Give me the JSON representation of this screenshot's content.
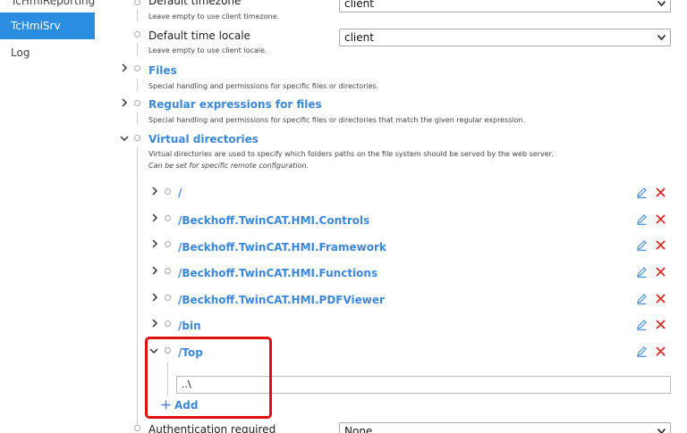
{
  "sidebar": {
    "items": [
      {
        "label": "TcHmiReporting",
        "active": false
      },
      {
        "label": "TcHmiSrv",
        "active": true
      },
      {
        "label": "Log",
        "active": false
      }
    ]
  },
  "settings": {
    "default_timezone": {
      "title": "Default timezone",
      "desc": "Leave empty to use client timezone.",
      "value": "client"
    },
    "default_time_locale": {
      "title": "Default time locale",
      "desc": "Leave empty to use client locale.",
      "value": "client"
    },
    "files": {
      "title": "Files",
      "desc": "Special handling and permissions for specific files or directories."
    },
    "regex": {
      "title": "Regular expressions for files",
      "desc": "Special handling and permissions for specific files or directories that match the given regular expression."
    },
    "virtual_directories": {
      "title": "Virtual directories",
      "desc": "Virtual directories are used to specify which folders paths on the file system should be served by the web server.",
      "desc2": "Can be set for specific remote configuration.",
      "entries": [
        {
          "path": "/"
        },
        {
          "path": "/Beckhoff.TwinCAT.HMI.Controls"
        },
        {
          "path": "/Beckhoff.TwinCAT.HMI.Framework"
        },
        {
          "path": "/Beckhoff.TwinCAT.HMI.Functions"
        },
        {
          "path": "/Beckhoff.TwinCAT.HMI.PDFViewer"
        },
        {
          "path": "/bin"
        },
        {
          "path": "/Top"
        }
      ],
      "top_value": "..\\",
      "add_label": "Add"
    },
    "authentication_required": {
      "title": "Authentication required",
      "value": "None"
    }
  },
  "colors": {
    "accent": "#2a8de0",
    "link": "#3d87d6",
    "delete": "#e02020",
    "highlight": "#e01010"
  },
  "icons": {
    "expand": "chevron-right-icon",
    "collapse": "chevron-down-icon",
    "edit": "pencil-icon",
    "delete": "close-icon",
    "add": "plus-icon"
  }
}
